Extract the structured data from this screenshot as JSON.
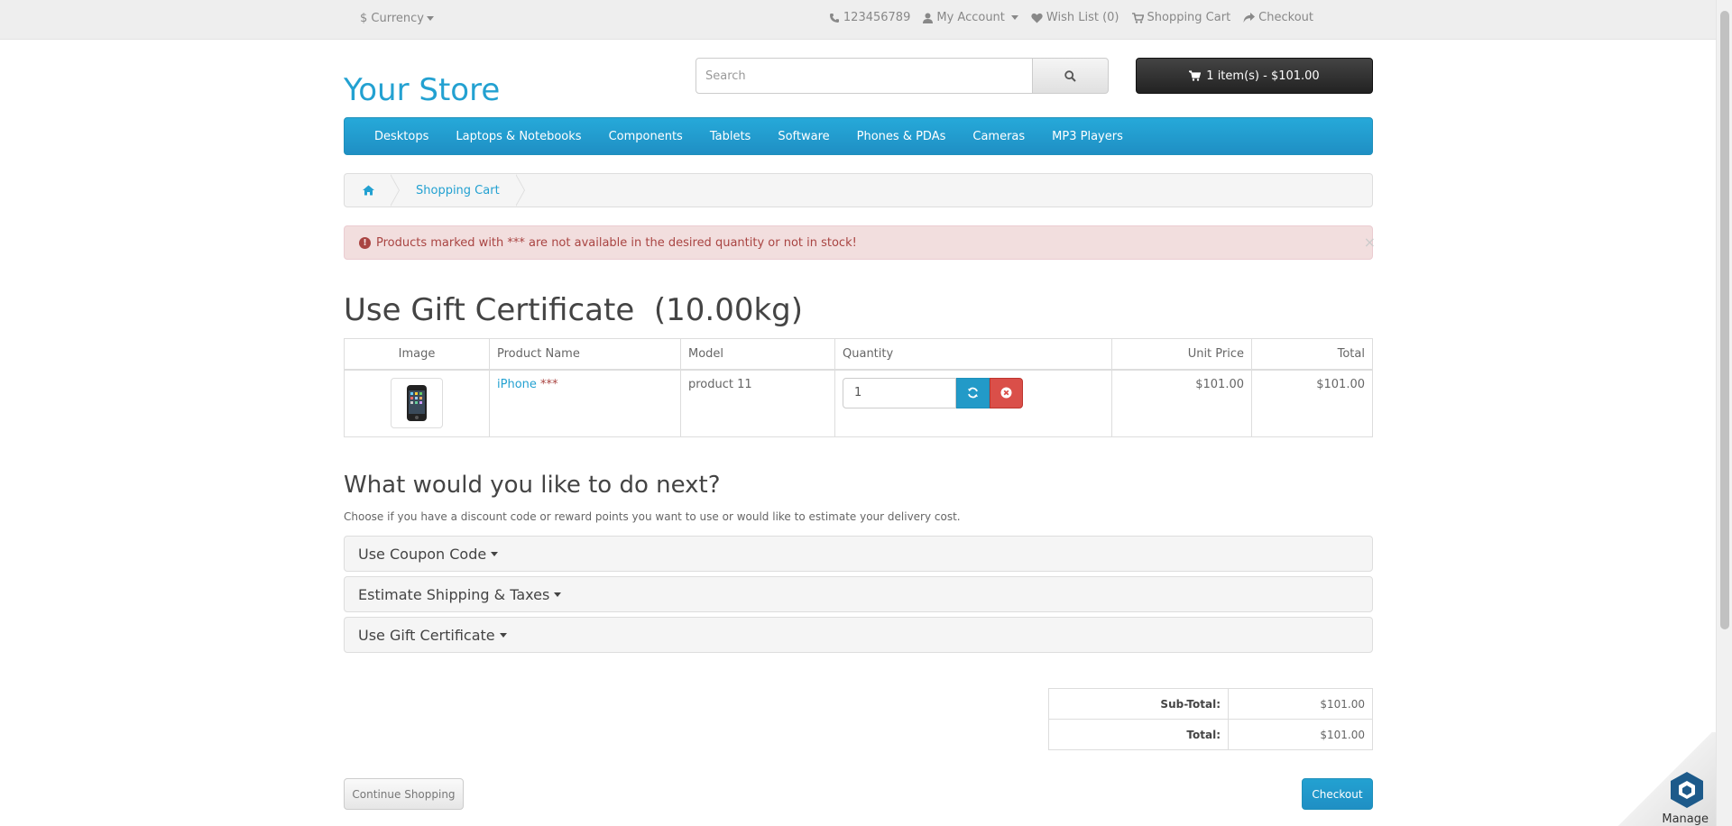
{
  "topbar": {
    "currency": "$ Currency",
    "phone": "123456789",
    "account": "My Account",
    "wishlist": "Wish List (0)",
    "shopping_cart": "Shopping Cart",
    "checkout": "Checkout"
  },
  "header": {
    "logo": "Your Store",
    "search_placeholder": "Search",
    "cart_summary": "1 item(s) - $101.00"
  },
  "menu": [
    "Desktops",
    "Laptops & Notebooks",
    "Components",
    "Tablets",
    "Software",
    "Phones & PDAs",
    "Cameras",
    "MP3 Players"
  ],
  "breadcrumb": {
    "current": "Shopping Cart"
  },
  "alert": {
    "message": "Products marked with *** are not available in the desired quantity or not in stock!",
    "close": "×"
  },
  "page": {
    "title": "Use Gift Certificate  (10.00kg)"
  },
  "cart_table": {
    "headers": {
      "image": "Image",
      "product_name": "Product Name",
      "model": "Model",
      "quantity": "Quantity",
      "unit_price": "Unit Price",
      "total": "Total"
    },
    "rows": [
      {
        "product_name": "iPhone",
        "stock_flag": "***",
        "model": "product 11",
        "quantity": "1",
        "unit_price": "$101.00",
        "total": "$101.00"
      }
    ]
  },
  "next": {
    "title": "What would you like to do next?",
    "description": "Choose if you have a discount code or reward points you want to use or would like to estimate your delivery cost.",
    "panels": [
      "Use Coupon Code",
      "Estimate Shipping & Taxes",
      "Use Gift Certificate"
    ]
  },
  "totals": [
    {
      "label": "Sub-Total:",
      "value": "$101.00"
    },
    {
      "label": "Total:",
      "value": "$101.00"
    }
  ],
  "actions": {
    "continue": "Continue Shopping",
    "checkout": "Checkout"
  },
  "widget": {
    "label": "Manage"
  },
  "colors": {
    "brand": "#23a1d1",
    "menu": "#229ac8",
    "danger": "#da4f49",
    "alert_bg": "#f2dede",
    "cart_button": "#333333"
  }
}
